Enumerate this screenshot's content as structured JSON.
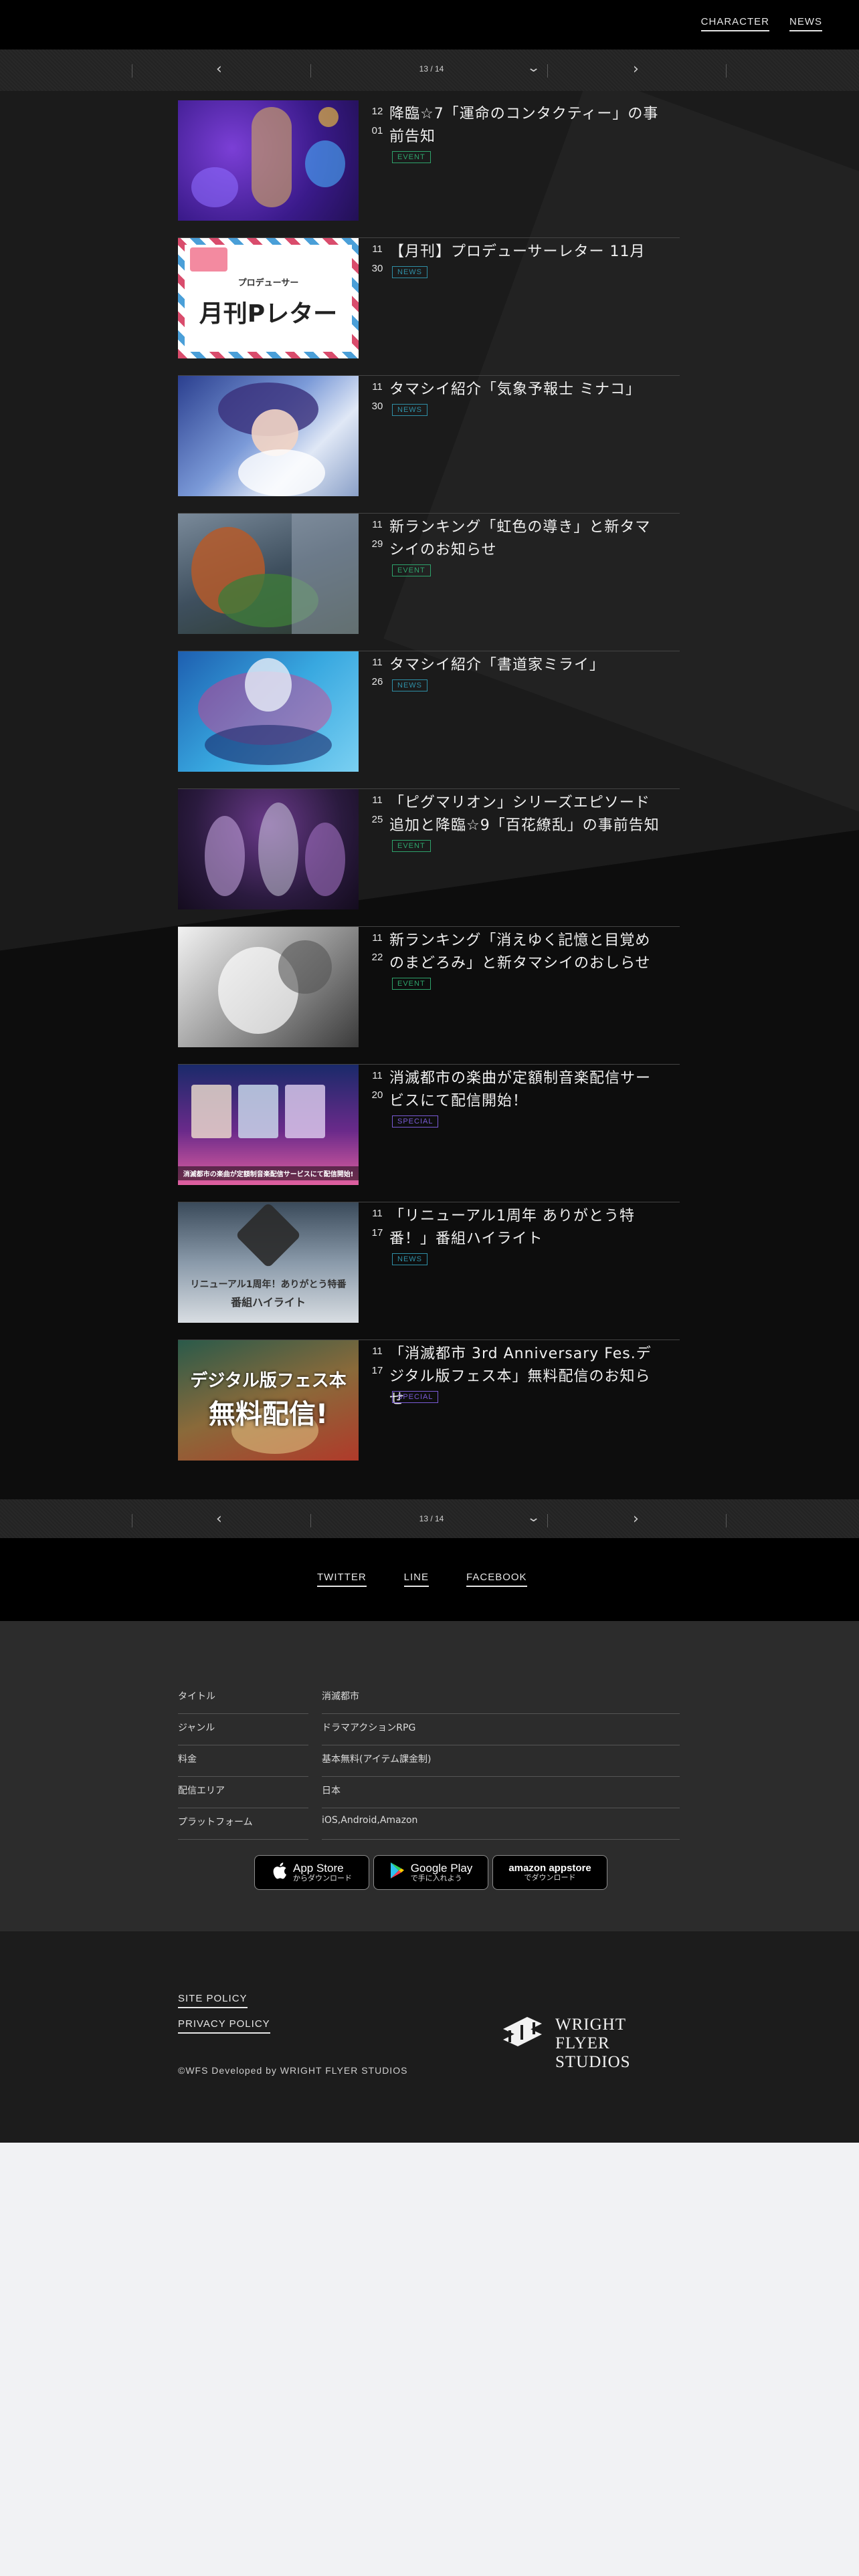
{
  "header": {
    "nav": [
      {
        "label": "CHARACTER"
      },
      {
        "label": "NEWS"
      }
    ]
  },
  "pager": {
    "prev_icon": "chevron-left-icon",
    "next_icon": "chevron-right-icon",
    "dropdown_icon": "chevron-down-icon",
    "label": "13 / 14"
  },
  "news": [
    {
      "month": "12",
      "day": "01",
      "title": "降臨☆7「運命のコンタクティー」の事前告知",
      "tag": "EVENT",
      "tag_color": "#2ea36b"
    },
    {
      "month": "11",
      "day": "30",
      "title": "【月刊】プロデューサーレター 11月",
      "tag": "NEWS",
      "tag_color": "#2f8fa6",
      "thumb_text_small": "プロデューサー",
      "thumb_text_big": "月刊Pレター"
    },
    {
      "month": "11",
      "day": "30",
      "title": "タマシイ紹介「気象予報士 ミナコ」",
      "tag": "NEWS",
      "tag_color": "#2f8fa6"
    },
    {
      "month": "11",
      "day": "29",
      "title": "新ランキング「虹色の導き」と新タマシイのお知らせ",
      "tag": "EVENT",
      "tag_color": "#2ea36b"
    },
    {
      "month": "11",
      "day": "26",
      "title": "タマシイ紹介「書道家ミライ」",
      "tag": "NEWS",
      "tag_color": "#2f8fa6"
    },
    {
      "month": "11",
      "day": "25",
      "title": "「ピグマリオン」シリーズエピソード追加と降臨☆9「百花繚乱」の事前告知",
      "tag": "EVENT",
      "tag_color": "#2ea36b"
    },
    {
      "month": "11",
      "day": "22",
      "title": "新ランキング「消えゆく記憶と目覚めのまどろみ」と新タマシイのおしらせ",
      "tag": "EVENT",
      "tag_color": "#2ea36b"
    },
    {
      "month": "11",
      "day": "20",
      "title": "消滅都市の楽曲が定額制音楽配信サービスにて配信開始！",
      "tag": "SPECIAL",
      "tag_color": "#7a5bd6",
      "thumb_text_small": "消滅都市の楽曲が定額制音楽配信サービスにて配信開始!"
    },
    {
      "month": "11",
      "day": "17",
      "title": "「リニューアル1周年 ありがとう特番！」番組ハイライト",
      "tag": "NEWS",
      "tag_color": "#2f8fa6",
      "thumb_text_small": "リニューアル1周年！ありがとう特番",
      "thumb_text_big": "番組ハイライト"
    },
    {
      "month": "11",
      "day": "17",
      "title": "「消滅都市 3rd Anniversary Fes.デジタル版フェス本」無料配信のお知らせ",
      "tag": "SPECIAL",
      "tag_color": "#7a5bd6",
      "thumb_text_small": "デジタル版フェス本",
      "thumb_text_big": "無料配信!"
    }
  ],
  "social": [
    {
      "label": "TWITTER"
    },
    {
      "label": "LINE"
    },
    {
      "label": "FACEBOOK"
    }
  ],
  "info": [
    {
      "label": "タイトル",
      "value": "消滅都市"
    },
    {
      "label": "ジャンル",
      "value": "ドラマアクションRPG"
    },
    {
      "label": "料金",
      "value": "基本無料(アイテム課金制)"
    },
    {
      "label": "配信エリア",
      "value": "日本"
    },
    {
      "label": "プラットフォーム",
      "value": "iOS,Android,Amazon"
    }
  ],
  "stores": [
    {
      "big": "App Store",
      "small": "からダウンロード",
      "icon": "apple-icon"
    },
    {
      "big": "Google Play",
      "small": "で手に入れよう",
      "icon": "google-play-icon"
    },
    {
      "big": "amazon appstore",
      "small": "でダウンロード",
      "icon": "amazon-icon"
    }
  ],
  "footer": {
    "site_policy": "SITE POLICY",
    "privacy_policy": "PRIVACY POLICY",
    "copyright": "©WFS Developed by WRIGHT FLYER STUDIOS",
    "logo_line1": "WRIGHT FLYER",
    "logo_line2": "STUDIOS"
  }
}
